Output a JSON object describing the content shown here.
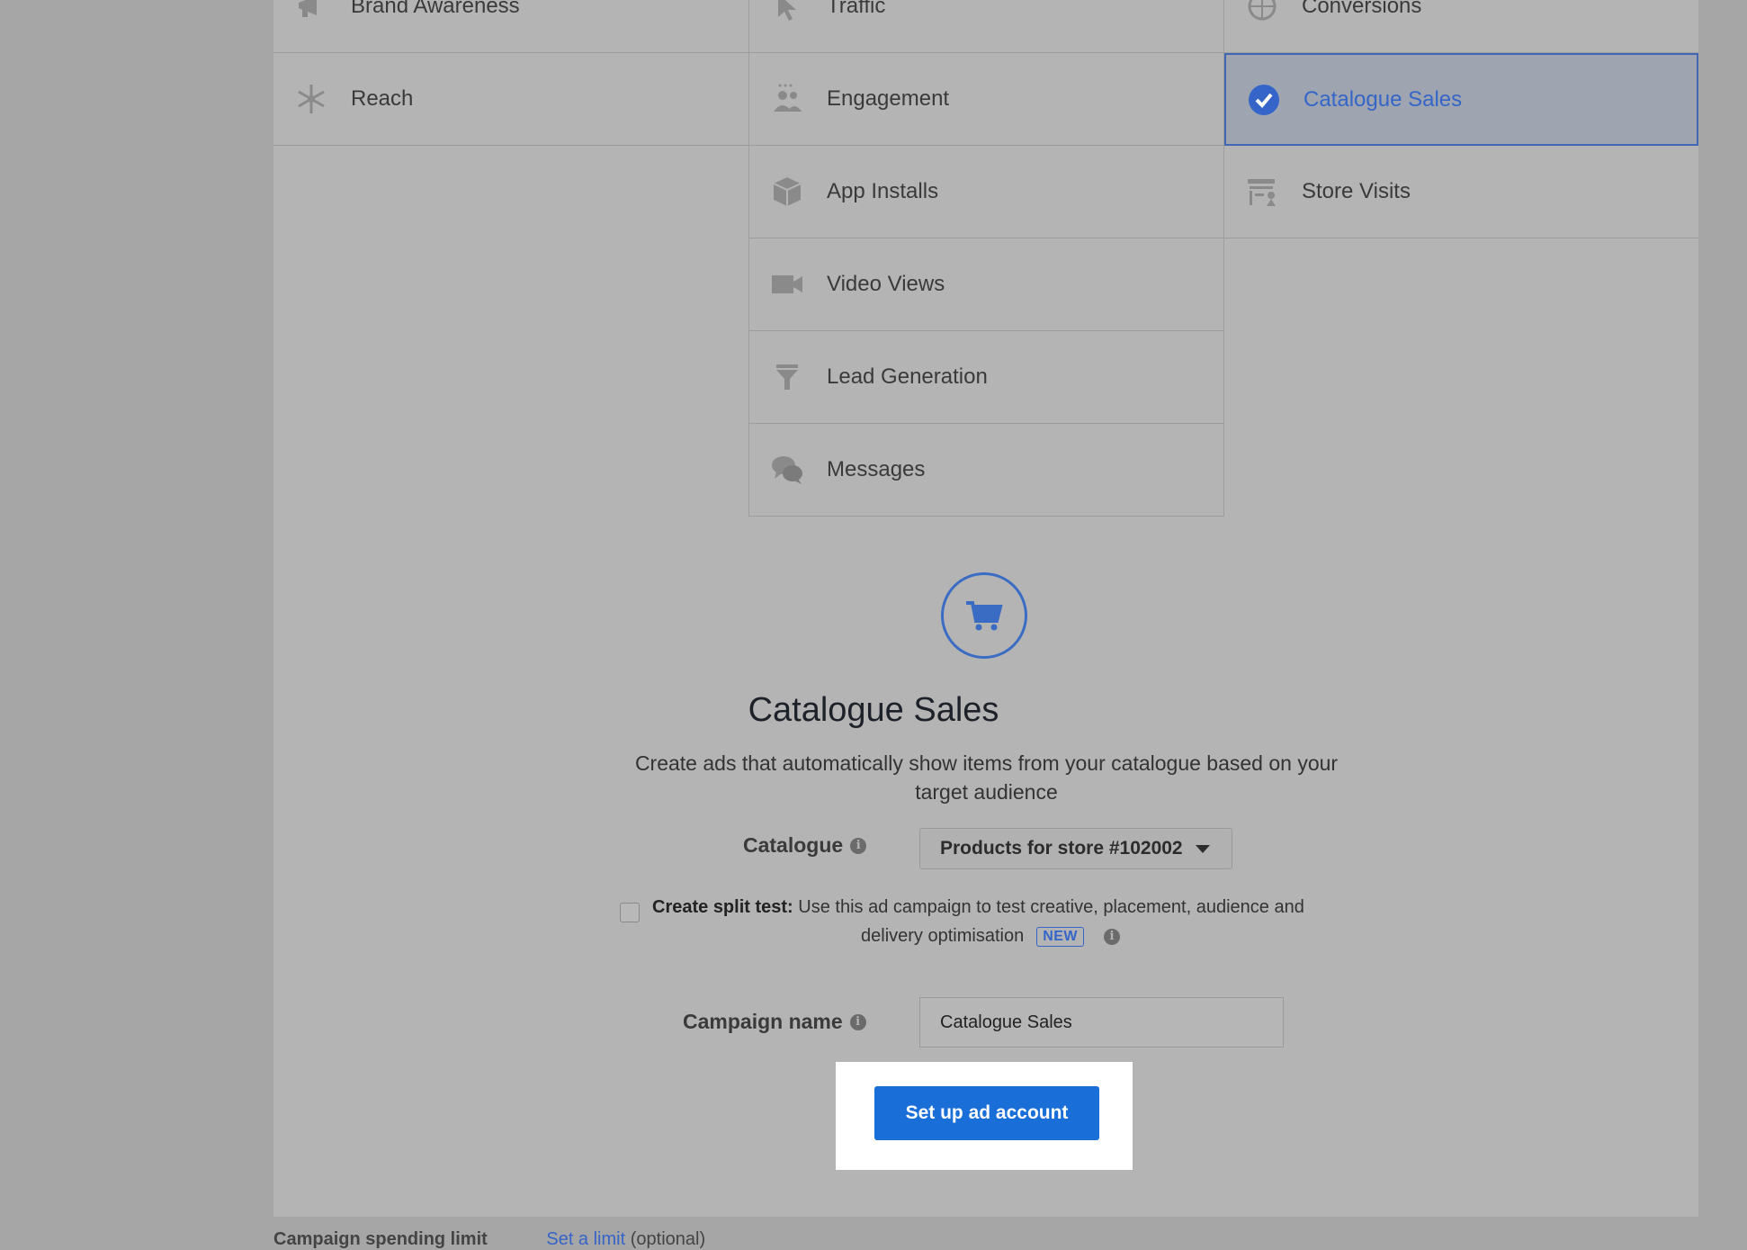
{
  "objectives": {
    "brand_awareness": "Brand Awareness",
    "traffic": "Traffic",
    "conversions": "Conversions",
    "reach": "Reach",
    "engagement": "Engagement",
    "catalogue_sales": "Catalogue Sales",
    "app_installs": "App Installs",
    "store_visits": "Store Visits",
    "video_views": "Video Views",
    "lead_generation": "Lead Generation",
    "messages": "Messages"
  },
  "selected_objective": "Catalogue Sales",
  "detail": {
    "title": "Catalogue Sales",
    "description": "Create ads that automatically show items from your catalogue based on your target audience",
    "catalogue_label": "Catalogue",
    "catalogue_value": "Products for store #102002",
    "split_test_bold": "Create split test:",
    "split_test_text": "Use this ad campaign to test creative, placement, audience and",
    "split_test_text2": "delivery optimisation",
    "new_badge": "NEW",
    "campaign_name_label": "Campaign name",
    "campaign_name_value": "Catalogue Sales",
    "setup_button": "Set up ad account"
  },
  "footer": {
    "spending_limit_label": "Campaign spending limit",
    "set_limit_link": "Set a limit",
    "optional_text": "(optional)"
  },
  "colors": {
    "accent": "#3565c8",
    "button": "#1a6ed8"
  }
}
